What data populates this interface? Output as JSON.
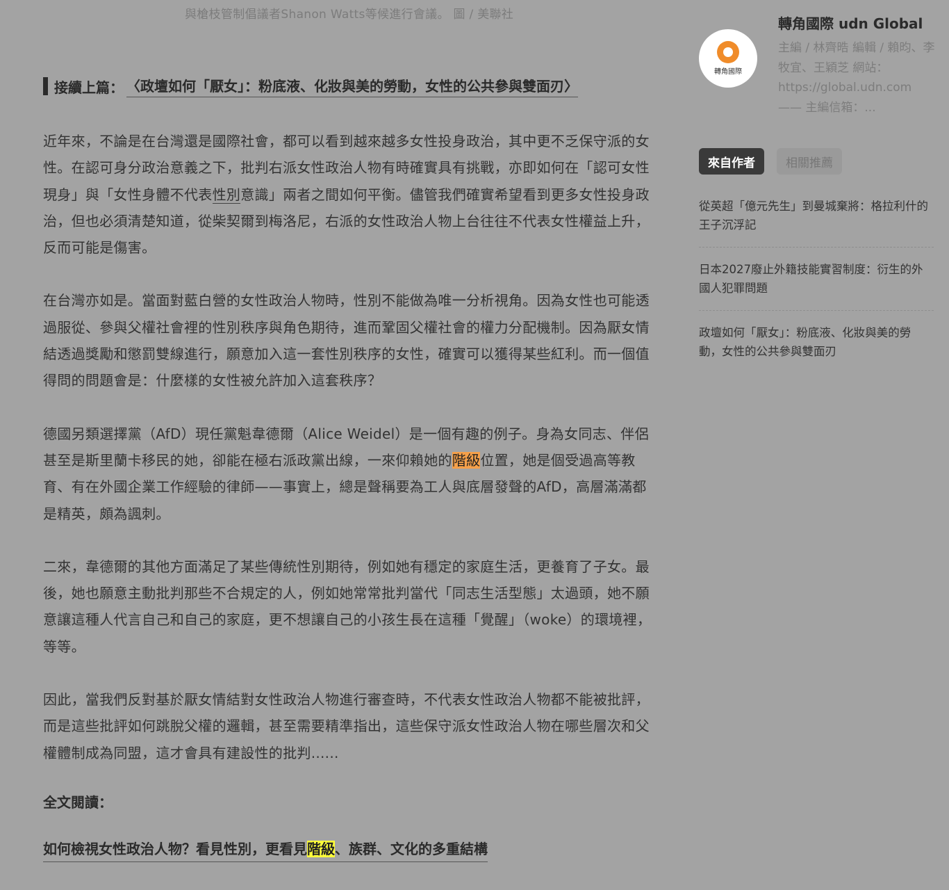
{
  "caption": "與槍枝管制倡議者Shanon Watts等候進行會議。 圖 / 美聯社",
  "prev_article": {
    "prefix": "接續上篇：",
    "title": "〈政壇如何「厭女」：粉底液、化妝與美的勞動，女性的公共參與雙面刃〉"
  },
  "paragraphs": {
    "p1": {
      "before": "近年來，不論是在台灣還是國際社會，都可以看到越來越多女性投身政治，其中更不乏保守派的女性。在認可身分政治意義之下，批判右派女性政治人物有時確實具有挑戰，亦即如何在「認可女性現身」與「女性身體不代表",
      "link": "性別",
      "after": "意識」兩者之間如何平衡。儘管我們確實希望看到更多女性投身政治，但也必須清楚知道，從柴契爾到梅洛尼，右派的女性政治人物上台往往不代表女性權益上升，反而可能是傷害。"
    },
    "p2": "在台灣亦如是。當面對藍白營的女性政治人物時，性別不能做為唯一分析視角。因為女性也可能透過服從、參與父權社會裡的性別秩序與角色期待，進而鞏固父權社會的權力分配機制。因為厭女情結透過獎勵和懲罰雙線進行，願意加入這一套性別秩序的女性，確實可以獲得某些紅利。而一個值得問的問題會是：什麼樣的女性被允許加入這套秩序？",
    "p3": {
      "before": "德國另類選擇黨（AfD）現任黨魁韋德爾（Alice Weidel）是一個有趣的例子。身為女同志、伴侶甚至是斯里蘭卡移民的她，卻能在極右派政黨出線，一來仰賴她的",
      "highlight": "階級",
      "after": "位置，她是個受過高等教育、有在外國企業工作經驗的律師——事實上，總是聲稱要為工人與底層發聲的AfD，高層滿滿都是精英，頗為諷刺。"
    },
    "p4": "二來，韋德爾的其他方面滿足了某些傳統性別期待，例如她有穩定的家庭生活，更養育了子女。最後，她也願意主動批判那些不合規定的人，例如她常常批判當代「同志生活型態」太過頭，她不願意讓這種人代言自己和自己的家庭，更不想讓自己的小孩生長在這種「覺醒」（woke）的環境裡，等等。",
    "p5": "因此，當我們反對基於厭女情結對女性政治人物進行審查時，不代表女性政治人物都不能被批評，而是這些批評如何跳脫父權的邏輯，甚至需要精準指出，這些保守派女性政治人物在哪些層次和父權體制成為同盟，這才會具有建設性的批判......"
  },
  "read_full_label": "全文閱讀：",
  "full_link": {
    "before": "如何檢視女性政治人物？看見性別，更看見",
    "highlight": "階級",
    "after": "、族群、文化的多重結構"
  },
  "sidebar": {
    "avatar_text": "轉角國際",
    "author_name": "轉角國際 udn Global",
    "author_desc": "主編 / 林齊晧 編輯 / 賴昀、李牧宜、王穎芝 網站：https://global.udn.com —— 主編信箱：...",
    "tabs": [
      "來自作者",
      "相關推薦"
    ],
    "related": [
      "從英超「億元先生」到曼城棄將：格拉利什的王子沉浮記",
      "日本2027廢止外籍技能實習制度：衍生的外國人犯罪問題",
      "政壇如何「厭女」：粉底液、化妝與美的勞動，女性的公共參與雙面刃"
    ]
  },
  "colors": {
    "background": "#a3a3a3",
    "highlight_orange": "#f5a04a",
    "highlight_yellow": "#ffff3a",
    "tab_active": "#3a3a3a"
  }
}
